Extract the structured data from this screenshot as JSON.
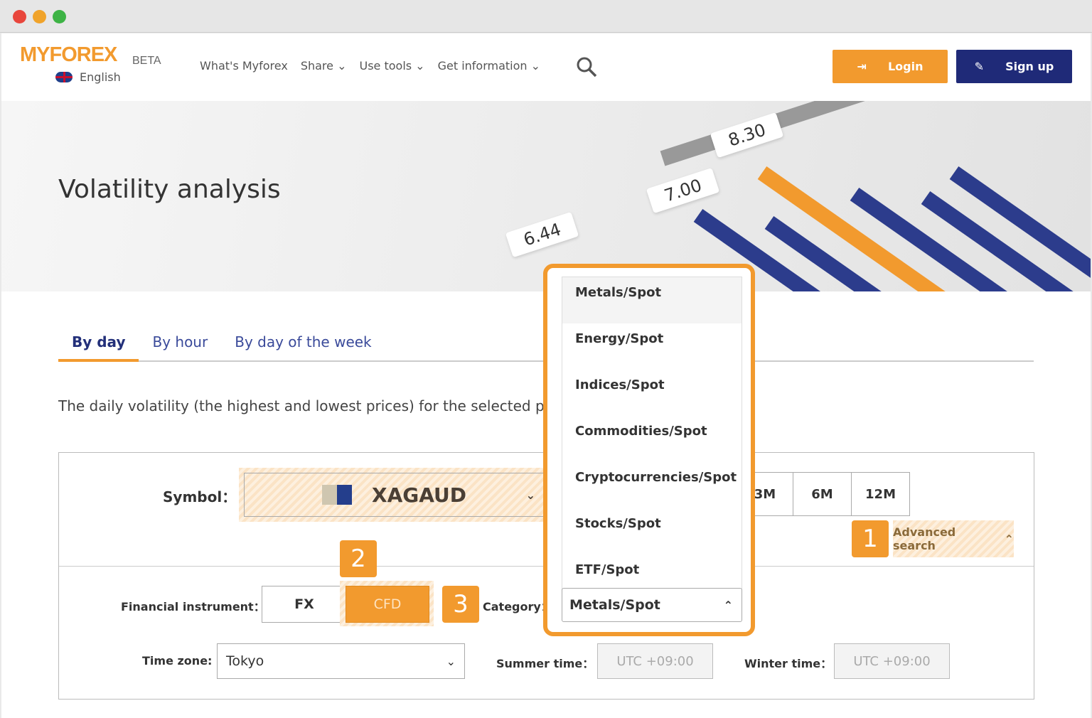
{
  "header": {
    "logo": "MYFOREX",
    "beta": "BETA",
    "language": "English",
    "nav": [
      "What's Myforex",
      "Share",
      "Use tools",
      "Get information"
    ],
    "login": "Login",
    "signup": "Sign up"
  },
  "hero": {
    "title": "Volatility analysis",
    "labels": [
      "6.44",
      "7.00",
      "8.30"
    ]
  },
  "tabs": [
    "By day",
    "By hour",
    "By day of the week"
  ],
  "description": "The daily volatility (the highest and lowest prices) for the selected peri",
  "form": {
    "symbol_label": "Symbol：",
    "symbol_value": "XAGAUD",
    "periods": [
      "3M",
      "6M",
      "12M"
    ],
    "advanced_search": "Advanced search",
    "instrument_label": "Financial instrument：",
    "fx": "FX",
    "cfd": "CFD",
    "category_label": "Category：",
    "category_value": "Metals/Spot",
    "category_options": [
      "Metals/Spot",
      "Energy/Spot",
      "Indices/Spot",
      "Commodities/Spot",
      "Cryptocurrencies/Spot",
      "Stocks/Spot",
      "ETF/Spot"
    ],
    "timezone_label": "Time zone:",
    "timezone_value": "Tokyo",
    "summer_label": "Summer time：",
    "summer_value": "UTC +09:00",
    "winter_label": "Winter time：",
    "winter_value": "UTC +09:00"
  },
  "badges": [
    "1",
    "2",
    "3"
  ],
  "colors": {
    "accent": "#f29a2e",
    "navy": "#1f2a78"
  }
}
